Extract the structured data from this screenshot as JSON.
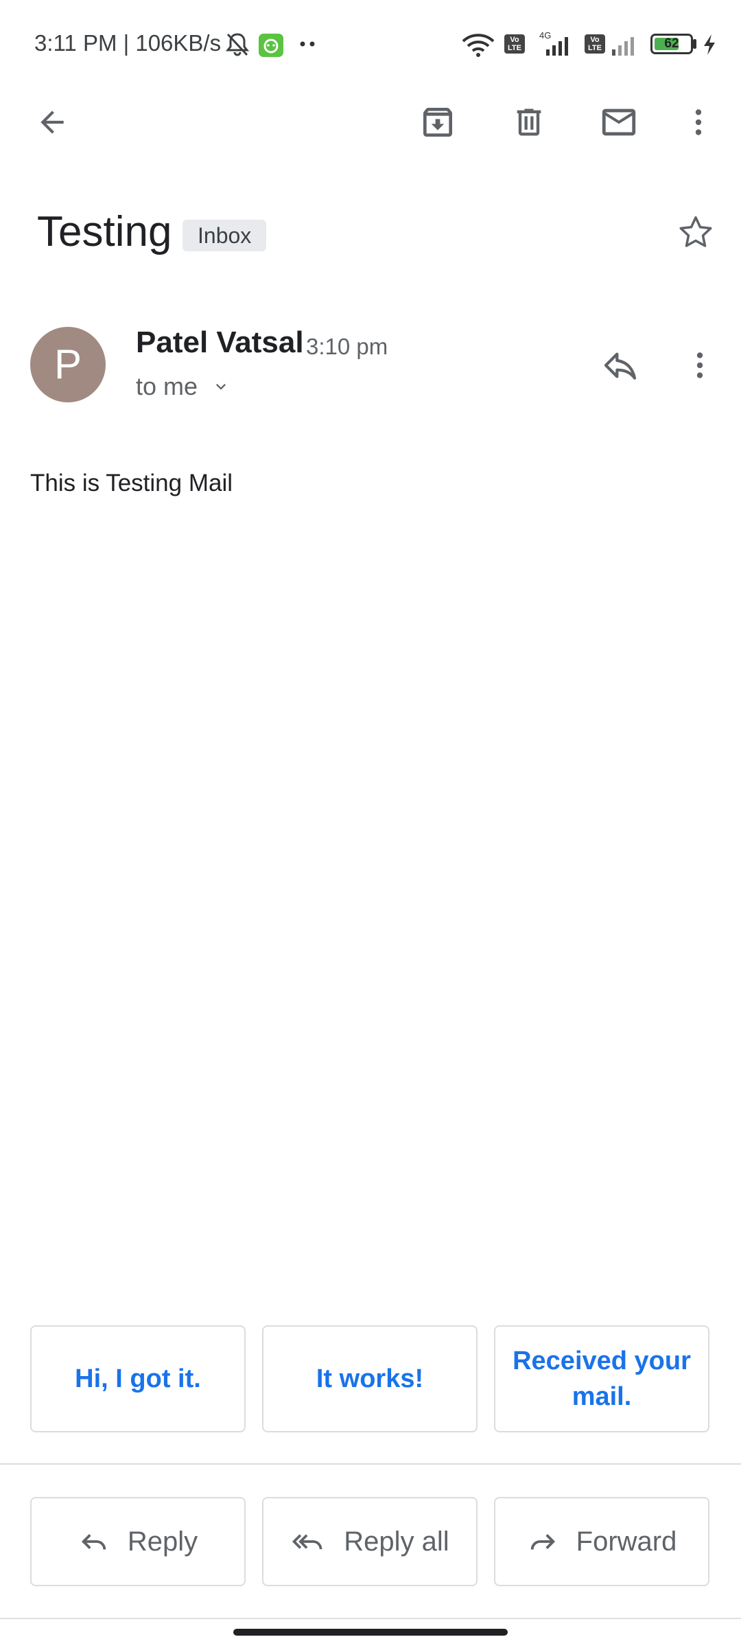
{
  "status_bar": {
    "time_speed": "3:11 PM | 106KB/s",
    "battery_level": "62",
    "sim1_badge": "Vo LTE",
    "sim2_badge": "Vo LTE",
    "network_label": "4G"
  },
  "toolbar": {
    "back_icon": "arrow-back-icon",
    "archive_icon": "archive-icon",
    "delete_icon": "delete-icon",
    "mark_unread_icon": "mail-icon",
    "more_icon": "more-vert-icon"
  },
  "email": {
    "subject": "Testing",
    "label": "Inbox",
    "sender_initial": "P",
    "sender_name": "Patel Vatsal",
    "time": "3:10 pm",
    "recipient": "to me",
    "body": "This is Testing Mail"
  },
  "smart_replies": [
    "Hi, I got it.",
    "It works!",
    "Received your mail."
  ],
  "actions": {
    "reply": "Reply",
    "reply_all": "Reply all",
    "forward": "Forward"
  },
  "colors": {
    "accent": "#1a73e8",
    "avatar": "#a18a82",
    "battery": "#4caf50"
  }
}
